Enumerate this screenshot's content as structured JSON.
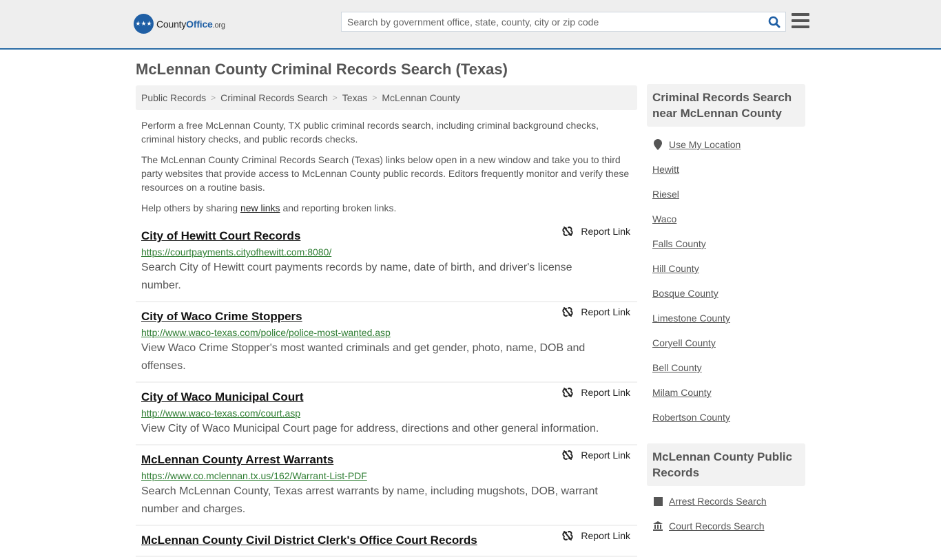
{
  "header": {
    "logo": {
      "brand_prefix": "County",
      "brand_main": "Office",
      "brand_suffix": ".org"
    },
    "search": {
      "placeholder": "Search by government office, state, county, city or zip code",
      "value": ""
    },
    "search_icon": "magnifier-icon",
    "menu_icon": "hamburger-icon"
  },
  "page": {
    "title": "McLennan County Criminal Records Search (Texas)"
  },
  "breadcrumb": [
    {
      "label": "Public Records"
    },
    {
      "label": "Criminal Records Search"
    },
    {
      "label": "Texas"
    },
    {
      "label": "McLennan County"
    }
  ],
  "intro": {
    "p1": "Perform a free McLennan County, TX public criminal records search, including criminal background checks, criminal history checks, and public records checks.",
    "p2": "The McLennan County Criminal Records Search (Texas) links below open in a new window and take you to third party websites that provide access to McLennan County public records. Editors frequently monitor and verify these resources on a routine basis.",
    "p3_before": "Help others by sharing ",
    "p3_link": "new links",
    "p3_after": " and reporting broken links."
  },
  "report_label": "Report Link",
  "records": [
    {
      "title": "City of Hewitt Court Records",
      "url": "https://courtpayments.cityofhewitt.com:8080/",
      "description": "Search City of Hewitt court payments records by name, date of birth, and driver's license number."
    },
    {
      "title": "City of Waco Crime Stoppers",
      "url": "http://www.waco-texas.com/police/police-most-wanted.asp",
      "description": "View Waco Crime Stopper's most wanted criminals and get gender, photo, name, DOB and offenses."
    },
    {
      "title": "City of Waco Municipal Court",
      "url": "http://www.waco-texas.com/court.asp",
      "description": "View City of Waco Municipal Court page for address, directions and other general information."
    },
    {
      "title": "McLennan County Arrest Warrants",
      "url": "https://www.co.mclennan.tx.us/162/Warrant-List-PDF",
      "description": "Search McLennan County, Texas arrest warrants by name, including mugshots, DOB, warrant number and charges."
    },
    {
      "title": "McLennan County Civil District Clerk's Office Court Records",
      "url": "",
      "description": ""
    }
  ],
  "sidebar": {
    "nearby_heading": "Criminal Records Search near McLennan County",
    "use_location": "Use My Location",
    "nearby": [
      "Hewitt",
      "Riesel",
      "Waco",
      "Falls County",
      "Hill County",
      "Bosque County",
      "Limestone County",
      "Coryell County",
      "Bell County",
      "Milam County",
      "Robertson County"
    ],
    "public_heading": "McLennan County Public Records",
    "public_links": [
      {
        "label": "Arrest Records Search",
        "icon": "square-icon"
      },
      {
        "label": "Court Records Search",
        "icon": "courthouse-icon"
      }
    ]
  },
  "colors": {
    "accent": "#2c6da6",
    "url_green": "#2e7d32",
    "header_bg": "#eeeeee"
  }
}
